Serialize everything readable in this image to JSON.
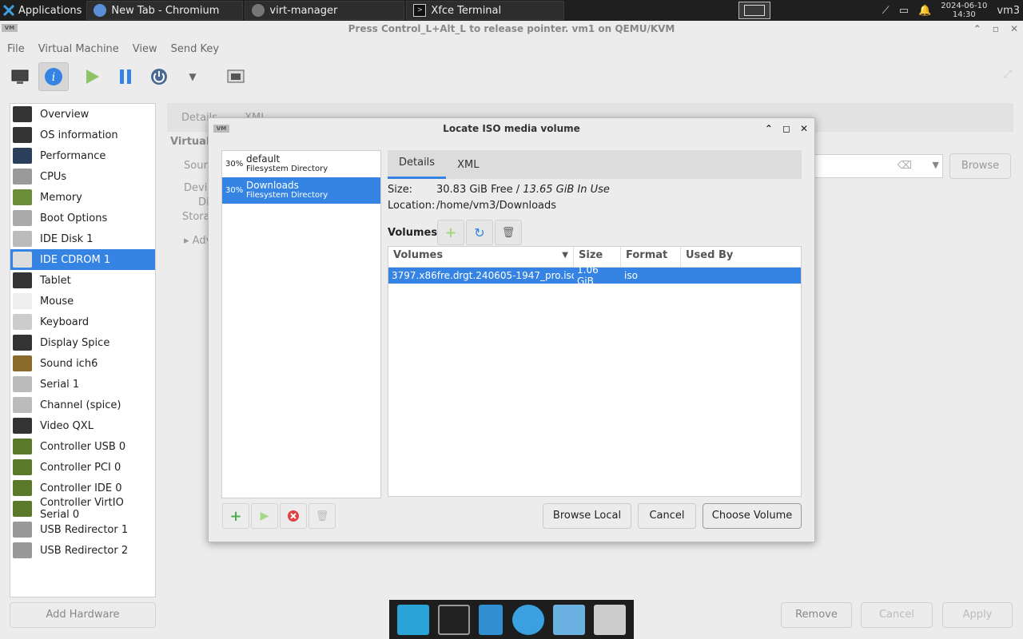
{
  "panel": {
    "apps_label": "Applications",
    "tasks": [
      {
        "label": "New Tab - Chromium"
      },
      {
        "label": "virt-manager"
      },
      {
        "label": "Xfce Terminal"
      }
    ],
    "clock_date": "2024-06-10",
    "clock_time": "14:30",
    "user": "vm3"
  },
  "window": {
    "title": "Press Control_L+Alt_L to release pointer. vm1 on QEMU/KVM",
    "menus": [
      "File",
      "Virtual Machine",
      "View",
      "Send Key"
    ]
  },
  "hardware": [
    {
      "label": "Overview",
      "icon": "monitor-icon",
      "color": "#333333"
    },
    {
      "label": "OS information",
      "icon": "monitor-icon",
      "color": "#333333"
    },
    {
      "label": "Performance",
      "icon": "chart-icon",
      "color": "#2a3f5a"
    },
    {
      "label": "CPUs",
      "icon": "cpu-icon",
      "color": "#9a9a9a"
    },
    {
      "label": "Memory",
      "icon": "memory-icon",
      "color": "#6b8e3a"
    },
    {
      "label": "Boot Options",
      "icon": "gear-icon",
      "color": "#aaaaaa"
    },
    {
      "label": "IDE Disk 1",
      "icon": "disk-icon",
      "color": "#bbbbbb"
    },
    {
      "label": "IDE CDROM 1",
      "icon": "cdrom-icon",
      "color": "#dddddd",
      "selected": true
    },
    {
      "label": "Tablet",
      "icon": "tablet-icon",
      "color": "#333333"
    },
    {
      "label": "Mouse",
      "icon": "mouse-icon",
      "color": "#eeeeee"
    },
    {
      "label": "Keyboard",
      "icon": "keyboard-icon",
      "color": "#cccccc"
    },
    {
      "label": "Display Spice",
      "icon": "monitor-icon",
      "color": "#333333"
    },
    {
      "label": "Sound ich6",
      "icon": "speaker-icon",
      "color": "#8a6a2a"
    },
    {
      "label": "Serial 1",
      "icon": "serial-icon",
      "color": "#bbbbbb"
    },
    {
      "label": "Channel (spice)",
      "icon": "channel-icon",
      "color": "#bbbbbb"
    },
    {
      "label": "Video QXL",
      "icon": "monitor-icon",
      "color": "#333333"
    },
    {
      "label": "Controller USB 0",
      "icon": "controller-icon",
      "color": "#5a7a2a"
    },
    {
      "label": "Controller PCI 0",
      "icon": "controller-icon",
      "color": "#5a7a2a"
    },
    {
      "label": "Controller IDE 0",
      "icon": "controller-icon",
      "color": "#5a7a2a"
    },
    {
      "label": "Controller VirtIO Serial 0",
      "icon": "controller-icon",
      "color": "#5a7a2a"
    },
    {
      "label": "USB Redirector 1",
      "icon": "usb-icon",
      "color": "#999999"
    },
    {
      "label": "USB Redirector 2",
      "icon": "usb-icon",
      "color": "#999999"
    }
  ],
  "add_hardware": "Add Hardware",
  "bg": {
    "tab_details": "Details",
    "tab_xml": "XML",
    "section": "Virtual",
    "source": "Sour",
    "device": "Devic",
    "device2": "Di",
    "storage": "Stora",
    "advanced": "Adv",
    "browse": "Browse",
    "remove": "Remove",
    "cancel": "Cancel",
    "apply": "Apply"
  },
  "dialog": {
    "title": "Locate ISO media volume",
    "pools": [
      {
        "pct": "30%",
        "name": "default",
        "type": "Filesystem Directory"
      },
      {
        "pct": "30%",
        "name": "Downloads",
        "type": "Filesystem Directory",
        "selected": true
      }
    ],
    "tabs": [
      "Details",
      "XML"
    ],
    "size_label": "Size:",
    "size_free": "30.83 GiB Free / ",
    "size_used": "13.65 GiB In Use",
    "location_label": "Location:",
    "location": "/home/vm3/Downloads",
    "volumes_label": "Volumes",
    "columns": [
      "Volumes",
      "Size",
      "Format",
      "Used By"
    ],
    "rows": [
      {
        "name": "3797.x86fre.dr​gt.240605-1947_pro.iso",
        "size": "1.06 GiB",
        "format": "iso",
        "used_by": ""
      }
    ],
    "browse_local": "Browse Local",
    "cancel": "Cancel",
    "choose": "Choose Volume"
  }
}
